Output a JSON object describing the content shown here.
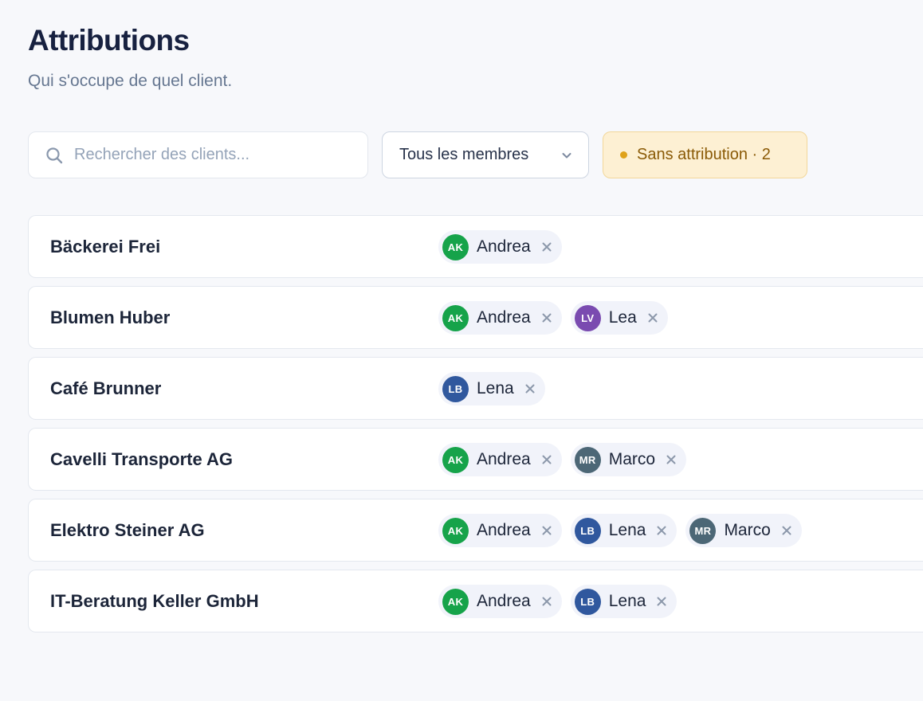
{
  "header": {
    "title": "Attributions",
    "subtitle": "Qui s'occupe de quel client."
  },
  "search": {
    "placeholder": "Rechercher des clients...",
    "value": ""
  },
  "member_filter": {
    "selected": "Tous les membres"
  },
  "unassigned_filter": {
    "label": "Sans attribution · 2"
  },
  "colors": {
    "AK": "#16a34a",
    "LV": "#7a4bb0",
    "LB": "#30589e",
    "MR": "#4c6776"
  },
  "clients": [
    {
      "name": "Bäckerei Frei",
      "members": [
        {
          "initials": "AK",
          "name": "Andrea"
        }
      ]
    },
    {
      "name": "Blumen Huber",
      "members": [
        {
          "initials": "AK",
          "name": "Andrea"
        },
        {
          "initials": "LV",
          "name": "Lea"
        }
      ]
    },
    {
      "name": "Café Brunner",
      "members": [
        {
          "initials": "LB",
          "name": "Lena"
        }
      ]
    },
    {
      "name": "Cavelli Transporte AG",
      "members": [
        {
          "initials": "AK",
          "name": "Andrea"
        },
        {
          "initials": "MR",
          "name": "Marco"
        }
      ]
    },
    {
      "name": "Elektro Steiner AG",
      "members": [
        {
          "initials": "AK",
          "name": "Andrea"
        },
        {
          "initials": "LB",
          "name": "Lena"
        },
        {
          "initials": "MR",
          "name": "Marco"
        }
      ]
    },
    {
      "name": "IT-Beratung Keller GmbH",
      "members": [
        {
          "initials": "AK",
          "name": "Andrea"
        },
        {
          "initials": "LB",
          "name": "Lena"
        }
      ]
    }
  ]
}
